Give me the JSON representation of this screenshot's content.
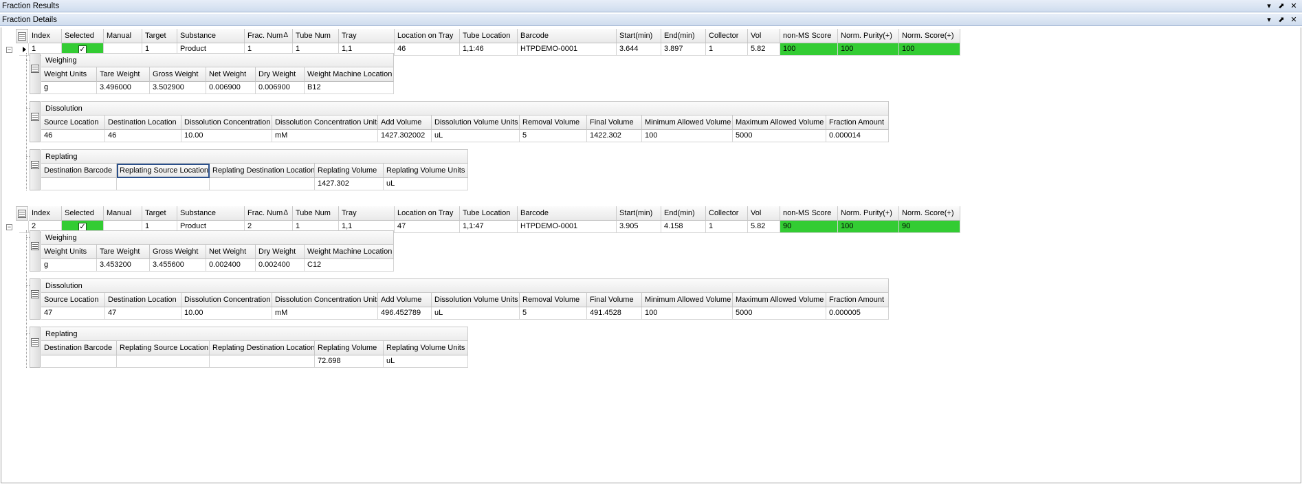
{
  "panels": {
    "outer_title": "Fraction Results",
    "inner_title": "Fraction Details",
    "pin_glyph": "▾",
    "dock_glyph": "⬈",
    "close_glyph": "✕"
  },
  "main_columns": [
    "Index",
    "Selected",
    "Manual",
    "Target",
    "Substance",
    "Frac. Num",
    "Tube Num",
    "Tray",
    "Location on Tray",
    "Tube Location",
    "Barcode",
    "Start(min)",
    "End(min)",
    "Collector",
    "Vol",
    "non-MS Score",
    "Norm. Purity(+)",
    "Norm. Score(+)"
  ],
  "sort_indicator": "Δ",
  "weighing": {
    "title": "Weighing",
    "columns": [
      "Weight Units",
      "Tare Weight",
      "Gross Weight",
      "Net Weight",
      "Dry Weight",
      "Weight Machine Location"
    ]
  },
  "dissolution": {
    "title": "Dissolution",
    "columns": [
      "Source Location",
      "Destination Location",
      "Dissolution Concentration",
      "Dissolution Concentration Units",
      "Add Volume",
      "Dissolution Volume Units",
      "Removal Volume",
      "Final Volume",
      "Minimum Allowed Volume",
      "Maximum Allowed Volume",
      "Fraction Amount"
    ]
  },
  "replating": {
    "title": "Replating",
    "columns": [
      "Destination Barcode",
      "Replating Source Location",
      "Replating Destination Location",
      "Replating Volume",
      "Replating Volume Units"
    ]
  },
  "fractions": [
    {
      "main": [
        "1",
        "",
        "",
        "1",
        "Product",
        "1",
        "1",
        "1,1",
        "46",
        "1,1:46",
        "HTPDEMO-0001",
        "3.644",
        "3.897",
        "1",
        "5.82",
        "100",
        "100",
        "100"
      ],
      "weighing": [
        "g",
        "3.496000",
        "3.502900",
        "0.006900",
        "0.006900",
        "B12"
      ],
      "dissolution": [
        "46",
        "46",
        "10.00",
        "mM",
        "1427.302002",
        "uL",
        "5",
        "1422.302",
        "100",
        "5000",
        "0.000014"
      ],
      "replating": [
        "",
        "",
        "",
        "1427.302",
        "uL"
      ]
    },
    {
      "main": [
        "2",
        "",
        "",
        "1",
        "Product",
        "2",
        "1",
        "1,1",
        "47",
        "1,1:47",
        "HTPDEMO-0001",
        "3.905",
        "4.158",
        "1",
        "5.82",
        "90",
        "100",
        "90"
      ],
      "weighing": [
        "g",
        "3.453200",
        "3.455600",
        "0.002400",
        "0.002400",
        "C12"
      ],
      "dissolution": [
        "47",
        "47",
        "10.00",
        "mM",
        "496.452789",
        "uL",
        "5",
        "491.4528",
        "100",
        "5000",
        "0.000005"
      ],
      "replating": [
        "",
        "",
        "",
        "72.698",
        "uL"
      ]
    }
  ],
  "colors": {
    "score_green": "#33cc33",
    "selected_green": "#33cc33"
  }
}
